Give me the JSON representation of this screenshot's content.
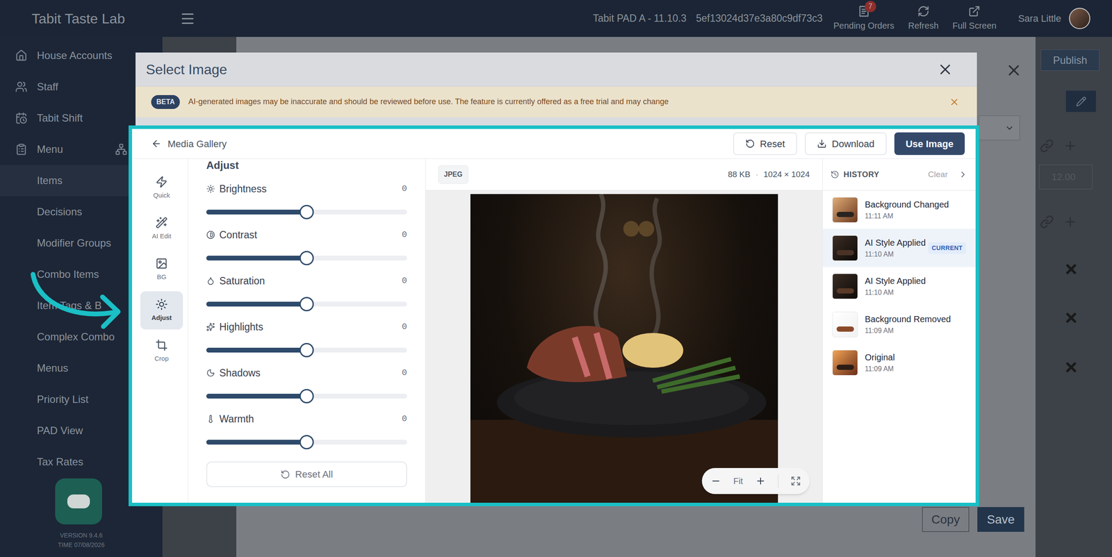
{
  "app": {
    "title": "Tabit Taste Lab"
  },
  "topbar": {
    "device": "Tabit PAD A - 11.10.3",
    "device_id": "5ef13024d37e3a80c9df73c3",
    "actions": [
      {
        "label": "Pending Orders",
        "badge": "7"
      },
      {
        "label": "Refresh",
        "badge": ""
      },
      {
        "label": "Full Screen",
        "badge": ""
      }
    ],
    "user": "Sara Little"
  },
  "sidebar": {
    "items": [
      {
        "label": "House Accounts",
        "kind": "section",
        "selected": false
      },
      {
        "label": "Staff",
        "kind": "section",
        "selected": false
      },
      {
        "label": "Tabit Shift",
        "kind": "section",
        "selected": false
      },
      {
        "label": "Menu",
        "kind": "section",
        "selected": false
      },
      {
        "label": "Items",
        "kind": "sub",
        "selected": true
      },
      {
        "label": "Decisions",
        "kind": "sub",
        "selected": false
      },
      {
        "label": "Modifier Groups",
        "kind": "sub",
        "selected": false
      },
      {
        "label": "Combo Items",
        "kind": "sub",
        "selected": false
      },
      {
        "label": "Item Tags & B",
        "kind": "sub",
        "selected": false
      },
      {
        "label": "Complex Combo",
        "kind": "sub",
        "selected": false
      },
      {
        "label": "Menus",
        "kind": "sub",
        "selected": false
      },
      {
        "label": "Priority List",
        "kind": "sub",
        "selected": false
      },
      {
        "label": "PAD View",
        "kind": "sub",
        "selected": false
      },
      {
        "label": "Tax Rates",
        "kind": "sub",
        "selected": false
      }
    ],
    "version": "VERSION 9.4.6",
    "time": "TIME 07/08/2026"
  },
  "page": {
    "publish": "Publish",
    "price": "12.00",
    "buttons": [
      "Copy",
      "Save"
    ]
  },
  "modal": {
    "title": "Select Image",
    "beta": {
      "badge": "BETA",
      "message": "AI-generated images may be inaccurate and should be reviewed before use. The feature is currently offered as a free trial and may change"
    },
    "editor": {
      "back": "Media Gallery",
      "actions": [
        {
          "label": "Reset",
          "primary": false
        },
        {
          "label": "Download",
          "primary": false
        },
        {
          "label": "Use Image",
          "primary": true
        }
      ],
      "tools": [
        {
          "label": "Quick",
          "selected": false
        },
        {
          "label": "AI Edit",
          "selected": false
        },
        {
          "label": "BG",
          "selected": false
        },
        {
          "label": "Adjust",
          "selected": true
        },
        {
          "label": "Crop",
          "selected": false
        }
      ],
      "panel": {
        "title": "Adjust",
        "sliders": [
          {
            "label": "Brightness",
            "value": "0",
            "level": 0.5
          },
          {
            "label": "Contrast",
            "value": "0",
            "level": 0.5
          },
          {
            "label": "Saturation",
            "value": "0",
            "level": 0.5
          },
          {
            "label": "Highlights",
            "value": "0",
            "level": 0.5
          },
          {
            "label": "Shadows",
            "value": "0",
            "level": 0.5
          },
          {
            "label": "Warmth",
            "value": "0",
            "level": 0.5
          }
        ],
        "reset": "Reset All"
      },
      "preview": {
        "format": "JPEG",
        "size": "88 KB",
        "separator": "·",
        "dimensions": "1024 × 1024",
        "zoom": "Fit"
      },
      "history": {
        "title": "HISTORY",
        "clear": "Clear",
        "current_label": "CURRENT",
        "items": [
          {
            "label": "Background Changed",
            "time": "11:11 AM",
            "selected": false,
            "current": false
          },
          {
            "label": "AI Style Applied",
            "time": "11:10 AM",
            "selected": true,
            "current": true
          },
          {
            "label": "AI Style Applied",
            "time": "11:10 AM",
            "selected": false,
            "current": false
          },
          {
            "label": "Background Removed",
            "time": "11:09 AM",
            "selected": false,
            "current": false
          },
          {
            "label": "Original",
            "time": "11:09 AM",
            "selected": false,
            "current": false
          }
        ]
      }
    }
  }
}
